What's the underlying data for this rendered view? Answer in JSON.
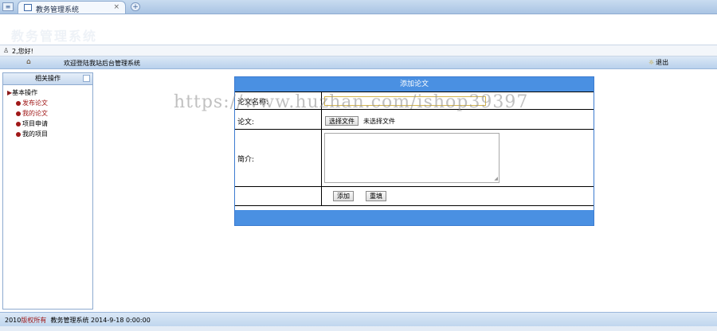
{
  "browser": {
    "tab_title": "教务管理系统",
    "tab_close": "×",
    "new_tab": "+",
    "menu_glyph": "≡"
  },
  "banner": {
    "faded_title": "教务管理系统"
  },
  "userbar": {
    "greeting": "2,您好!"
  },
  "navbar": {
    "welcome": "欢迎登陆我站后台管理系统",
    "logout": "退出"
  },
  "sidebar": {
    "header": "相关操作",
    "root": "基本操作",
    "items": [
      {
        "label": "发布论文",
        "color": "#a01818"
      },
      {
        "label": "我的论文",
        "color": "#a01818"
      },
      {
        "label": "项目申请",
        "color": "#000000"
      },
      {
        "label": "我的项目",
        "color": "#000000"
      }
    ]
  },
  "form": {
    "header": "添加论文",
    "title_label": "论文名称:",
    "file_label": "论文:",
    "file_button": "选择文件",
    "file_status": "未选择文件",
    "intro_label": "简介:",
    "submit": "添加",
    "reset": "重填"
  },
  "watermark": "https://www.huzhan.com/ishop39397",
  "footer": {
    "year": "2010",
    "rights": "版权所有",
    "system": "教务管理系统",
    "date": "2014-9-18 0:00:00"
  },
  "colors": {
    "accent": "#4a90e2",
    "nav": "#b9d1ec",
    "link_red": "#a01818"
  }
}
